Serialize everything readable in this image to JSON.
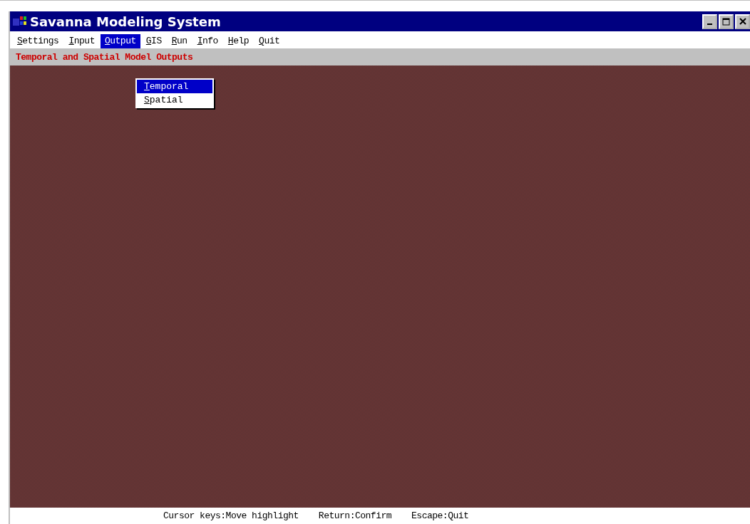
{
  "window": {
    "title": "Savanna Modeling System"
  },
  "menu": [
    {
      "label": "Settings",
      "selected": false
    },
    {
      "label": "Input",
      "selected": false
    },
    {
      "label": "Output",
      "selected": true
    },
    {
      "label": "GIS",
      "selected": false
    },
    {
      "label": "Run",
      "selected": false
    },
    {
      "label": "Info",
      "selected": false
    },
    {
      "label": "Help",
      "selected": false
    },
    {
      "label": "Quit",
      "selected": false
    }
  ],
  "subtitle": "Temporal and Spatial Model Outputs",
  "dropdown": [
    {
      "label": "Temporal",
      "selected": true
    },
    {
      "label": "Spatial",
      "selected": false
    }
  ],
  "status_bar": [
    "Cursor keys:Move highlight",
    "Return:Confirm",
    "Escape:Quit"
  ]
}
